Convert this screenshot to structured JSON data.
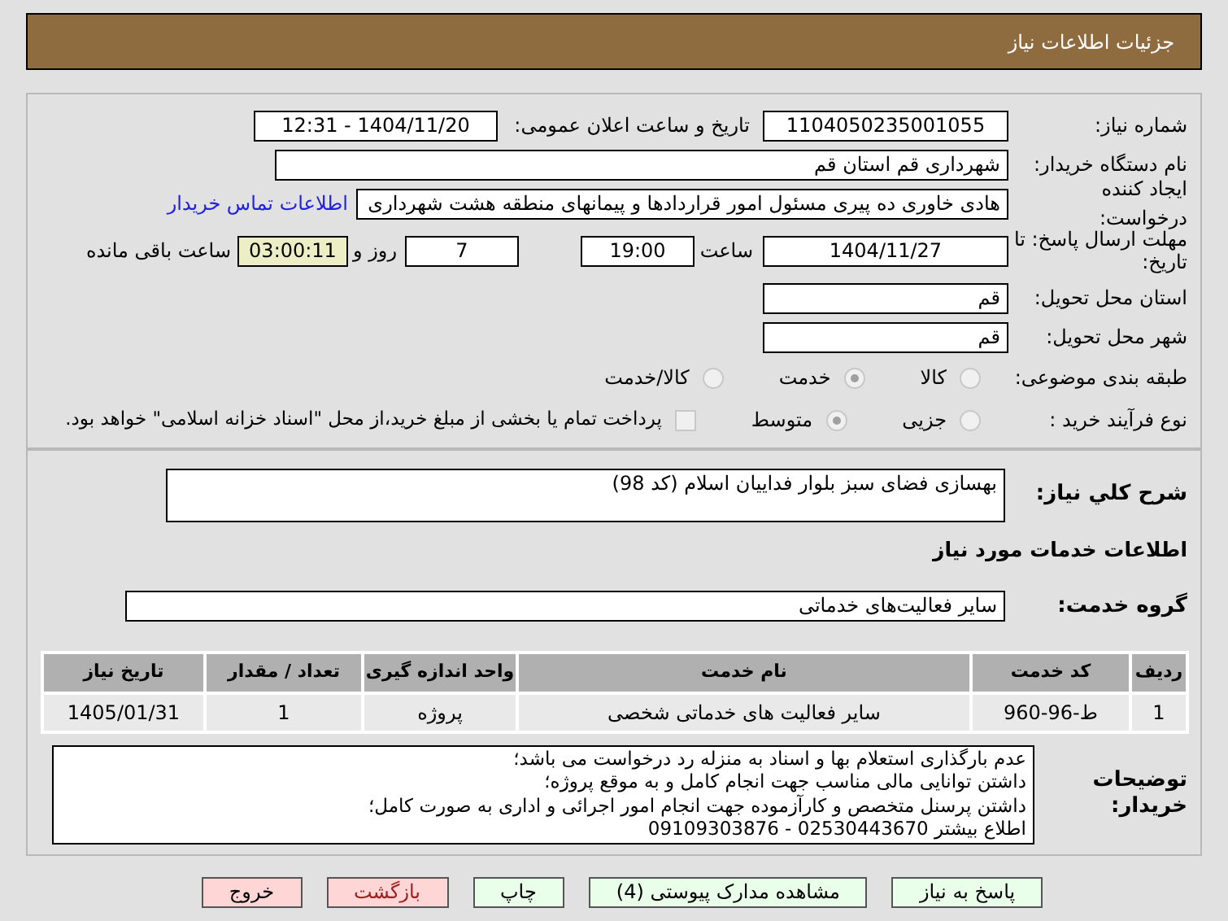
{
  "header": {
    "title": "جزئیات اطلاعات نیاز"
  },
  "need_info": {
    "need_number_label": "شماره نیاز:",
    "need_number": "1104050235001055",
    "announce_label": "تاریخ و ساعت اعلان عمومی:",
    "announce_value": "1404/11/20 - 12:31",
    "buyer_label": "نام دستگاه خریدار:",
    "buyer": "شهرداری قم استان قم",
    "creator_label": "ایجاد کننده درخواست:",
    "creator": "هادی خاوری ده پیری مسئول امور قراردادها و پیمانهای منطقه هشت شهرداری",
    "contact_link": "اطلاعات تماس خریدار",
    "deadline_label": "مهلت ارسال پاسخ: تا تاریخ:",
    "deadline_date": "1404/11/27",
    "time_label": "ساعت",
    "deadline_time": "19:00",
    "days": "7",
    "days_label": "روز و",
    "remaining": "03:00:11",
    "remaining_label": "ساعت باقی مانده",
    "province_label": "استان محل تحویل:",
    "province": "قم",
    "city_label": "شهر محل تحویل:",
    "city": "قم",
    "category_label": "طبقه بندی موضوعی:",
    "categories": [
      {
        "label": "کالا",
        "selected": false
      },
      {
        "label": "خدمت",
        "selected": true
      },
      {
        "label": "کالا/خدمت",
        "selected": false
      }
    ],
    "purchase_label": "نوع فرآیند خرید :",
    "purchase_types": [
      {
        "label": "جزیی",
        "selected": false
      },
      {
        "label": "متوسط",
        "selected": true
      }
    ],
    "payment_checked": false,
    "payment_text": "پرداخت تمام یا بخشی از مبلغ خرید،از محل \"اسناد خزانه اسلامی\" خواهد بود."
  },
  "details": {
    "description_label": "شرح کلي نیاز:",
    "description": "بهسازی فضای سبز بلوار فداییان اسلام (کد 98)",
    "services_heading": "اطلاعات خدمات مورد نیاز",
    "group_label": "گروه خدمت:",
    "group": "سایر فعالیت‌های خدماتی",
    "table": {
      "columns": [
        "ردیف",
        "کد خدمت",
        "نام خدمت",
        "واحد اندازه گیری",
        "تعداد / مقدار",
        "تاریخ نیاز"
      ],
      "rows": [
        [
          "1",
          "ط-96-960",
          "سایر فعالیت های خدماتی شخصی",
          "پروژه",
          "1",
          "1405/01/31"
        ]
      ]
    },
    "notes_label": "توضیحات خریدار:",
    "notes": [
      "عدم بارگذاری استعلام بها و اسناد به منزله رد درخواست می باشد؛",
      "داشتن توانایی مالی مناسب جهت انجام کامل و به موقع پروژه؛",
      "داشتن پرسنل متخصص و کارآزموده جهت انجام امور اجرائی و اداری به صورت کامل؛",
      "اطلاع بیشتر 02530443670 - 09109303876"
    ]
  },
  "buttons": [
    {
      "label": "پاسخ به نیاز",
      "kind": "primary"
    },
    {
      "label": "مشاهده مدارک پیوستی (4)",
      "kind": "primary"
    },
    {
      "label": "چاپ",
      "kind": "primary"
    },
    {
      "label": "بازگشت",
      "kind": "danger"
    },
    {
      "label": "خروج",
      "kind": "danger"
    }
  ]
}
